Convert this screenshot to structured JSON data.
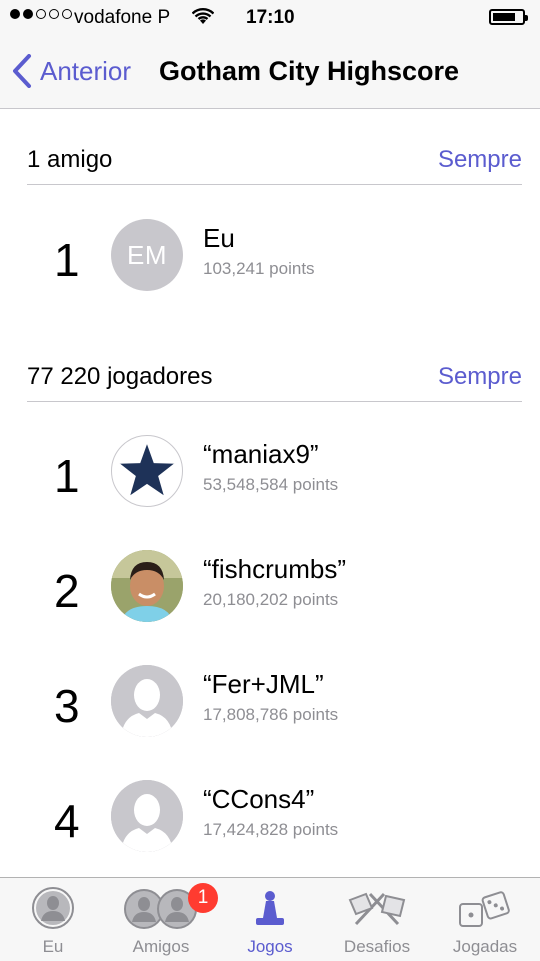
{
  "status_bar": {
    "carrier": "vodafone P",
    "time": "17:10"
  },
  "nav": {
    "back_label": "Anterior",
    "title": "Gotham City Highscore"
  },
  "friends_section": {
    "count_label": "1 amigo",
    "filter_label": "Sempre",
    "rows": [
      {
        "rank": "1",
        "initials": "EM",
        "name": "Eu",
        "points": "103,241 points"
      }
    ]
  },
  "players_section": {
    "count_label": "77 220 jogadores",
    "filter_label": "Sempre",
    "rows": [
      {
        "rank": "1",
        "name": "“maniax9”",
        "points": "53,548,584 points",
        "avatar": "star-avatar"
      },
      {
        "rank": "2",
        "name": "“fishcrumbs”",
        "points": "20,180,202 points",
        "avatar": "photo-avatar"
      },
      {
        "rank": "3",
        "name": "“Fer+JML”",
        "points": "17,808,786 points",
        "avatar": "silhouette-avatar"
      },
      {
        "rank": "4",
        "name": "“CCons4”",
        "points": "17,424,828 points",
        "avatar": "silhouette-avatar"
      }
    ]
  },
  "tab_bar": {
    "tabs": [
      {
        "label": "Eu",
        "icon": "person-icon"
      },
      {
        "label": "Amigos",
        "icon": "friends-icon",
        "badge": "1"
      },
      {
        "label": "Jogos",
        "icon": "game-piece-icon",
        "active": true
      },
      {
        "label": "Desafios",
        "icon": "flags-icon"
      },
      {
        "label": "Jogadas",
        "icon": "dice-icon"
      }
    ]
  },
  "colors": {
    "accent": "#5b5ccf",
    "secondary_text": "#8e8e93",
    "badge": "#ff3b30",
    "avatar_placeholder": "#c8c7cc",
    "star": "#1e3258"
  }
}
